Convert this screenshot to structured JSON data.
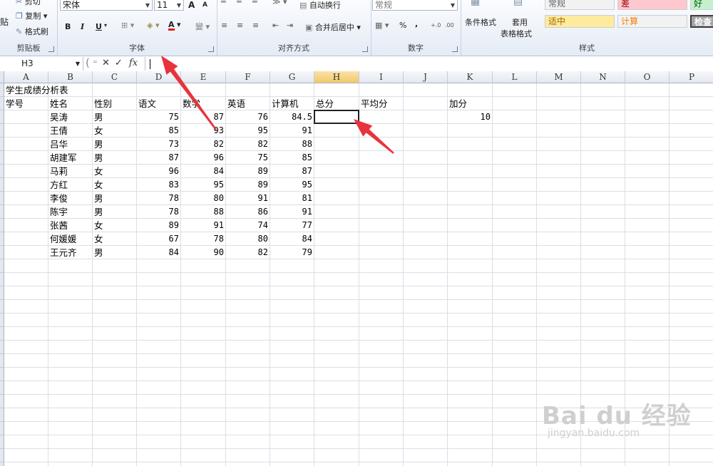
{
  "ribbon": {
    "clipboard": {
      "paste_label": "贴",
      "cut_label": "剪切",
      "copy_label": "复制",
      "format_painter_label": "格式刷",
      "group_label": "剪贴板"
    },
    "font": {
      "font_name": "宋体",
      "font_size": "11",
      "grow_label": "A",
      "shrink_label": "A",
      "bold": "B",
      "italic": "I",
      "underline": "U",
      "font_color_label": "A",
      "phonetic_label": "變",
      "group_label": "字体"
    },
    "alignment": {
      "wrap_text_label": "自动换行",
      "merge_center_label": "合并后居中",
      "group_label": "对齐方式"
    },
    "number": {
      "format_value": "常规",
      "percent_label": "%",
      "comma_label": ",",
      "group_label": "数字"
    },
    "styles": {
      "conditional_label": "条件格式",
      "table_format_label_1": "套用",
      "table_format_label_2": "表格格式",
      "style_normal": "常规",
      "style_bad": "差",
      "style_good": "好",
      "style_neutral": "适中",
      "style_calc": "计算",
      "style_check": "检查",
      "group_label": "样式"
    }
  },
  "formula_bar": {
    "name_box": "H3",
    "cancel_icon": "✕",
    "enter_icon": "✓",
    "fx_label": "fx",
    "formula": ""
  },
  "columns": [
    "A",
    "B",
    "C",
    "D",
    "E",
    "F",
    "G",
    "H",
    "I",
    "J",
    "K",
    "L",
    "M",
    "N",
    "O",
    "P"
  ],
  "active_column": "H",
  "sheet": {
    "title": "学生成绩分析表",
    "headers": {
      "A": "学号",
      "B": "姓名",
      "C": "性别",
      "D": "语文",
      "E": "数学",
      "F": "英语",
      "G": "计算机",
      "H": "总分",
      "I": "平均分",
      "K": "加分"
    },
    "bonus_value": "10",
    "rows": [
      {
        "name": "吴涛",
        "gender": "男",
        "chinese": "75",
        "math": "87",
        "english": "76",
        "computer": "84.5"
      },
      {
        "name": "王倩",
        "gender": "女",
        "chinese": "85",
        "math": "93",
        "english": "95",
        "computer": "91"
      },
      {
        "name": "吕华",
        "gender": "男",
        "chinese": "73",
        "math": "82",
        "english": "82",
        "computer": "88"
      },
      {
        "name": "胡建军",
        "gender": "男",
        "chinese": "87",
        "math": "96",
        "english": "75",
        "computer": "85"
      },
      {
        "name": "马莉",
        "gender": "女",
        "chinese": "96",
        "math": "84",
        "english": "89",
        "computer": "87"
      },
      {
        "name": "方红",
        "gender": "女",
        "chinese": "83",
        "math": "95",
        "english": "89",
        "computer": "95"
      },
      {
        "name": "李俊",
        "gender": "男",
        "chinese": "78",
        "math": "80",
        "english": "91",
        "computer": "81"
      },
      {
        "name": "陈宇",
        "gender": "男",
        "chinese": "78",
        "math": "88",
        "english": "86",
        "computer": "91"
      },
      {
        "name": "张茜",
        "gender": "女",
        "chinese": "89",
        "math": "91",
        "english": "74",
        "computer": "77"
      },
      {
        "name": "何媛媛",
        "gender": "女",
        "chinese": "67",
        "math": "78",
        "english": "80",
        "computer": "84"
      },
      {
        "name": "王元齐",
        "gender": "男",
        "chinese": "84",
        "math": "90",
        "english": "82",
        "computer": "79"
      }
    ]
  },
  "watermark": {
    "brand": "Bai du 经验",
    "url": "jingyan.baidu.com"
  },
  "colors": {
    "annotation_arrow": "#e8333c",
    "active_header": "#f2c867",
    "ribbon_bg": "#e4ebf5"
  }
}
